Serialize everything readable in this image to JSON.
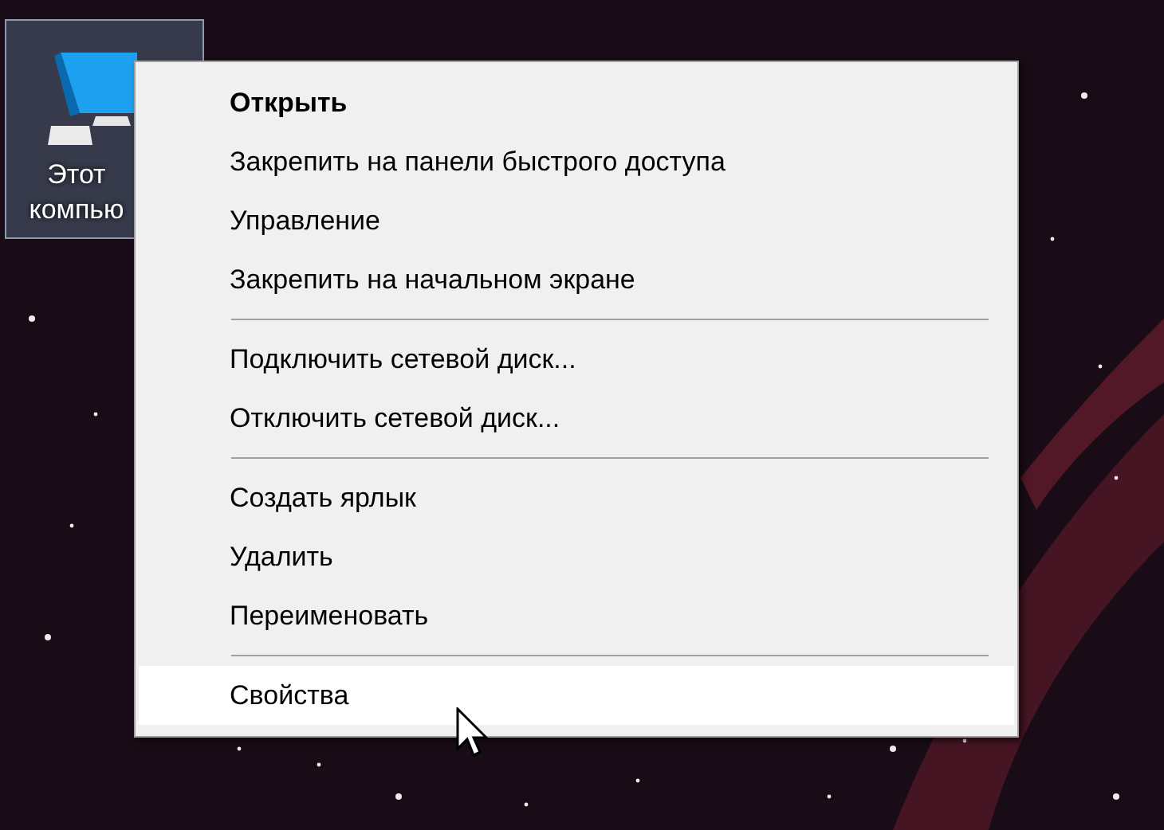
{
  "desktop_icon": {
    "label": "Этот компью",
    "selected": true
  },
  "context_menu": {
    "items": [
      {
        "kind": "item",
        "label": "Открыть",
        "default": true,
        "selected": false
      },
      {
        "kind": "item",
        "label": "Закрепить на панели быстрого доступа",
        "default": false,
        "selected": false
      },
      {
        "kind": "item",
        "label": "Управление",
        "default": false,
        "selected": false
      },
      {
        "kind": "item",
        "label": "Закрепить на начальном экране",
        "default": false,
        "selected": false
      },
      {
        "kind": "separator"
      },
      {
        "kind": "item",
        "label": "Подключить сетевой диск...",
        "default": false,
        "selected": false
      },
      {
        "kind": "item",
        "label": "Отключить сетевой диск...",
        "default": false,
        "selected": false
      },
      {
        "kind": "separator"
      },
      {
        "kind": "item",
        "label": "Создать ярлык",
        "default": false,
        "selected": false
      },
      {
        "kind": "item",
        "label": "Удалить",
        "default": false,
        "selected": false
      },
      {
        "kind": "item",
        "label": "Переименовать",
        "default": false,
        "selected": false
      },
      {
        "kind": "separator"
      },
      {
        "kind": "item",
        "label": "Свойства",
        "default": false,
        "selected": true
      }
    ]
  }
}
